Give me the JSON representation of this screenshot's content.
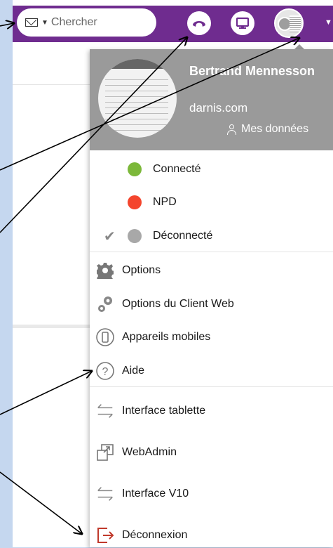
{
  "search": {
    "placeholder": "Chercher"
  },
  "profile": {
    "name": "Bertrand Mennesson",
    "domain": "darnis.com",
    "my_data_label": "Mes données"
  },
  "status": [
    {
      "label": "Connecté",
      "color": "#7cb83a",
      "selected": false
    },
    {
      "label": "NPD",
      "color": "#f4452d",
      "selected": false
    },
    {
      "label": "Déconnecté",
      "color": "#a8a8a8",
      "selected": true
    }
  ],
  "menu": {
    "options": "Options",
    "web_client_options": "Options du Client Web",
    "mobile_devices": "Appareils mobiles",
    "help": "Aide",
    "tablet_interface": "Interface tablette",
    "webadmin": "WebAdmin",
    "v10_interface": "Interface V10",
    "logout": "Déconnexion"
  },
  "icons": {
    "phone": "phone-icon",
    "screen": "monitor-icon",
    "options": "gear-icon",
    "web_client_options": "gears-icon",
    "mobile": "mobile-icon",
    "help": "help-icon",
    "tablet": "swap-arrows-icon",
    "webadmin": "external-window-icon",
    "v10": "swap-arrows-icon",
    "logout": "logout-icon"
  },
  "colors": {
    "topbar": "#6f2c8f",
    "profile_bg": "#9a9a9a",
    "logout_icon": "#c0392b",
    "background": "#c5d7ef"
  }
}
